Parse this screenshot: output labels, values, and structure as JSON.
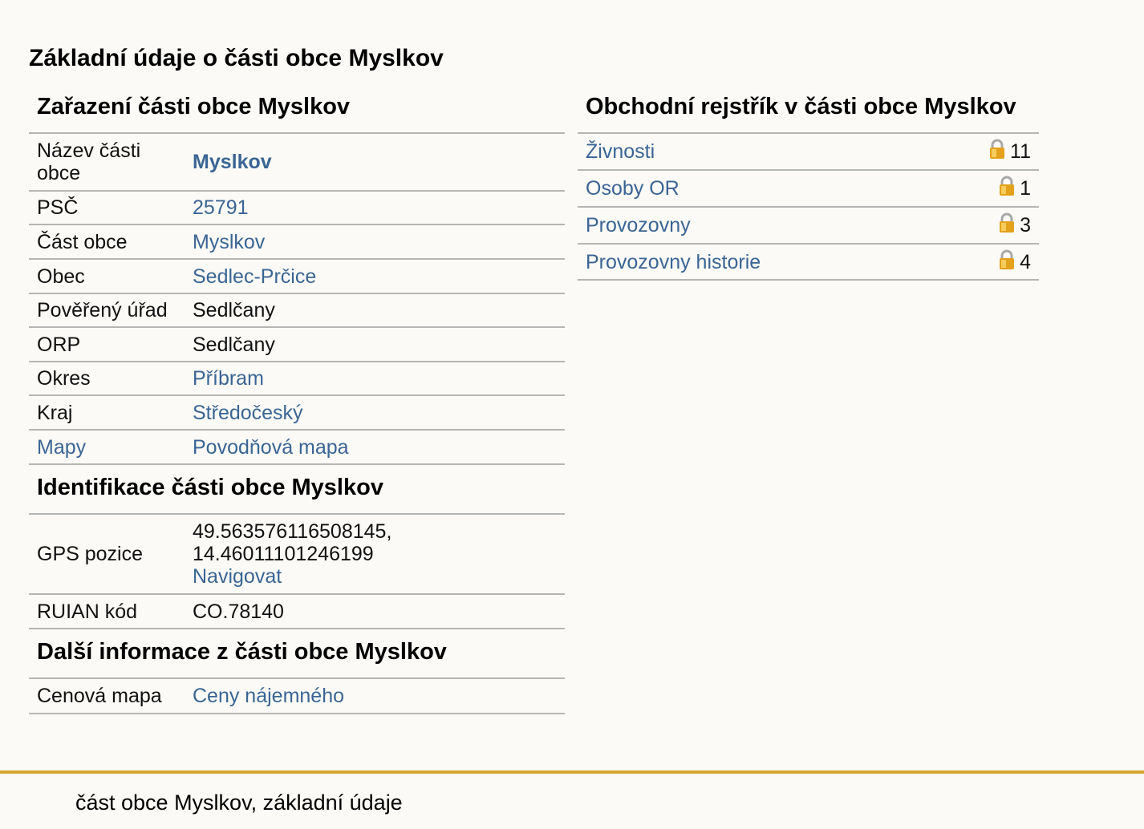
{
  "page_title": "Základní údaje o části obce Myslkov",
  "zarazeni": {
    "heading": "Zařazení části obce Myslkov",
    "rows": [
      {
        "label": "Název části obce",
        "value": "Myslkov",
        "link": true,
        "bold": true
      },
      {
        "label": "PSČ",
        "value": "25791",
        "link": true
      },
      {
        "label": "Část obce",
        "value": "Myslkov",
        "link": true
      },
      {
        "label": "Obec",
        "value": "Sedlec-Prčice",
        "link": true
      },
      {
        "label": "Pověřený úřad",
        "value": "Sedlčany",
        "link": false
      },
      {
        "label": "ORP",
        "value": "Sedlčany",
        "link": false
      },
      {
        "label": "Okres",
        "value": "Příbram",
        "link": true
      },
      {
        "label": "Kraj",
        "value": "Středočeský",
        "link": true
      },
      {
        "label": "Mapy",
        "value": "Povodňová mapa",
        "link": true,
        "label_link": true
      }
    ]
  },
  "identifikace": {
    "heading": "Identifikace části obce Myslkov",
    "gps_label": "GPS pozice",
    "gps_lat": "49.563576116508145,",
    "gps_lon": "14.46011101246199",
    "gps_navigate": "Navigovat",
    "ruian_label": "RUIAN kód",
    "ruian_value": "CO.78140"
  },
  "dalsi": {
    "heading": "Další informace z části obce Myslkov",
    "cenova_label": "Cenová mapa",
    "cenova_value": "Ceny nájemného"
  },
  "rejstrik": {
    "heading": "Obchodní rejstřík v části obce Myslkov",
    "rows": [
      {
        "name": "Živnosti",
        "count": "11"
      },
      {
        "name": "Osoby OR",
        "count": "1"
      },
      {
        "name": "Provozovny",
        "count": "3"
      },
      {
        "name": "Provozovny historie",
        "count": "4"
      }
    ]
  },
  "footer": {
    "text": "část obce Myslkov, základní údaje"
  },
  "colors": {
    "link": "#3a6594",
    "footer_rule": "#d5a730",
    "background": "#fbfaf6",
    "lock_gold": "#e3a11c"
  },
  "icons": {
    "lock": "lock-icon"
  }
}
